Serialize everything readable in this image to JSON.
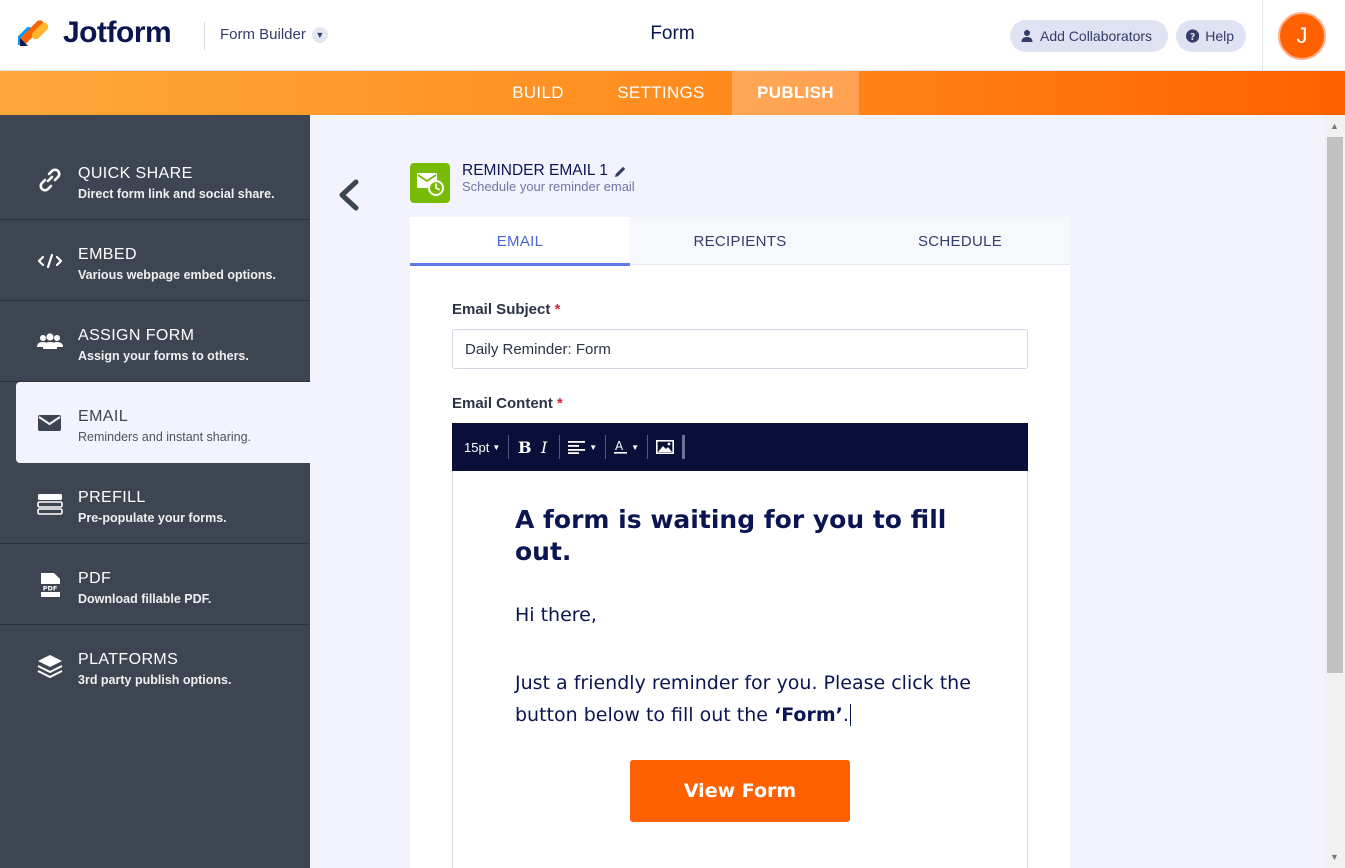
{
  "header": {
    "logo_text": "Jotform",
    "builder_label": "Form Builder",
    "form_title": "Form",
    "collab_label": "Add Collaborators",
    "help_label": "Help",
    "avatar_initial": "J"
  },
  "nav": {
    "build": "BUILD",
    "settings": "SETTINGS",
    "publish": "PUBLISH"
  },
  "sidebar": {
    "items": [
      {
        "title": "QUICK SHARE",
        "desc": "Direct form link and social share.",
        "icon": "link-icon"
      },
      {
        "title": "EMBED",
        "desc": "Various webpage embed options.",
        "icon": "code-icon"
      },
      {
        "title": "ASSIGN FORM",
        "desc": "Assign your forms to others.",
        "icon": "users-icon"
      },
      {
        "title": "EMAIL",
        "desc": "Reminders and instant sharing.",
        "icon": "envelope-icon"
      },
      {
        "title": "PREFILL",
        "desc": "Pre-populate your forms.",
        "icon": "prefill-icon"
      },
      {
        "title": "PDF",
        "desc": "Download fillable PDF.",
        "icon": "pdf-icon"
      },
      {
        "title": "PLATFORMS",
        "desc": "3rd party publish options.",
        "icon": "layers-icon"
      }
    ]
  },
  "reminder": {
    "title": "REMINDER EMAIL 1",
    "subtitle": "Schedule your reminder email"
  },
  "tabs": {
    "email": "EMAIL",
    "recipients": "RECIPIENTS",
    "schedule": "SCHEDULE"
  },
  "form": {
    "subject_label": "Email Subject",
    "subject_value": "Daily Reminder: Form",
    "content_label": "Email Content",
    "required_mark": "*"
  },
  "toolbar": {
    "font_size": "15pt"
  },
  "editor": {
    "heading": "A form is waiting for you to fill out.",
    "greeting": "Hi there,",
    "body_prefix": "Just a friendly reminder for you. Please click the button below to fill out the ",
    "body_bold": "‘Form’",
    "body_suffix": ".",
    "button_label": "View Form"
  },
  "colors": {
    "accent_orange": "#ff6100",
    "sidebar_bg": "#3e4552",
    "navy": "#0a1551",
    "active_tab": "#4a65d6",
    "reminder_icon_bg": "#78bb07"
  }
}
